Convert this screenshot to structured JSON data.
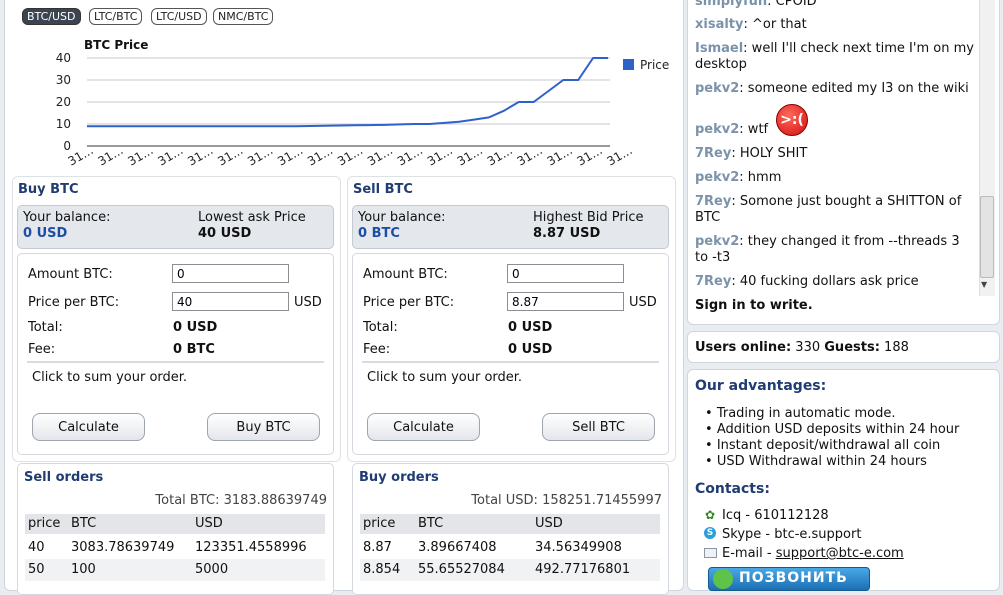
{
  "pairs": [
    "BTC/USD",
    "LTC/BTC",
    "LTC/USD",
    "NMC/BTC"
  ],
  "chart": {
    "title": "BTC Price",
    "legend": "Price",
    "tick_label": "31..."
  },
  "chart_data": {
    "type": "line",
    "title": "BTC Price",
    "series": [
      {
        "name": "Price",
        "color": "#2f62c9",
        "values": [
          9,
          9,
          9,
          9,
          9,
          9,
          9,
          9,
          9,
          9,
          9,
          9,
          9,
          9,
          9,
          9.1,
          9.2,
          9.3,
          9.4,
          9.5,
          9.6,
          9.8,
          10,
          10,
          10.5,
          11,
          12,
          13,
          16,
          20,
          20,
          25,
          30,
          30,
          40,
          40
        ]
      }
    ],
    "ylim": [
      0,
      40
    ],
    "yticks": [
      0,
      10,
      20,
      30,
      40
    ],
    "xtick_labels": [
      "31...",
      "31...",
      "31...",
      "31...",
      "31...",
      "31...",
      "31...",
      "31...",
      "31...",
      "31...",
      "31...",
      "31...",
      "31...",
      "31...",
      "31...",
      "31...",
      "31...",
      "31...",
      "31..."
    ]
  },
  "buy": {
    "title": "Buy BTC",
    "balance_label": "Your balance:",
    "balance_value": "0 USD",
    "price_label": "Lowest ask Price",
    "price_value": "40 USD",
    "amount_label": "Amount BTC:",
    "amount_value": "0",
    "ppb_label": "Price per BTC:",
    "ppb_value": "40",
    "ppb_unit": "USD",
    "total_label": "Total:",
    "total_value": "0 USD",
    "fee_label": "Fee:",
    "fee_value": "0 BTC",
    "hint": "Click to sum your order.",
    "calc_label": "Calculate",
    "action_label": "Buy BTC"
  },
  "sell": {
    "title": "Sell BTC",
    "balance_label": "Your balance:",
    "balance_value": "0 BTC",
    "price_label": "Highest Bid Price",
    "price_value": "8.87 USD",
    "amount_label": "Amount BTC:",
    "amount_value": "0",
    "ppb_label": "Price per BTC:",
    "ppb_value": "8.87",
    "ppb_unit": "USD",
    "total_label": "Total:",
    "total_value": "0 USD",
    "fee_label": "Fee:",
    "fee_value": "0 USD",
    "hint": "Click to sum your order.",
    "calc_label": "Calculate",
    "action_label": "Sell BTC"
  },
  "sell_orders": {
    "title": "Sell orders",
    "total": "Total BTC: 3183.88639749",
    "columns": [
      "price",
      "BTC",
      "USD"
    ],
    "rows": [
      [
        "40",
        "3083.78639749",
        "123351.4558996"
      ],
      [
        "50",
        "100",
        "5000"
      ]
    ]
  },
  "buy_orders": {
    "title": "Buy orders",
    "total": "Total USD: 158251.71455997",
    "columns": [
      "price",
      "BTC",
      "USD"
    ],
    "rows": [
      [
        "8.87",
        "3.89667408",
        "34.56349908"
      ],
      [
        "8.854",
        "55.65527084",
        "492.77176801"
      ]
    ]
  },
  "chat": [
    {
      "nick": "simplyfun",
      "text": ": CPOID"
    },
    {
      "nick": "xisalty",
      "text": ": ^or that"
    },
    {
      "nick": "Ismael",
      "text": ": well I'll check next time I'm on my desktop"
    },
    {
      "nick": "pekv2",
      "text": ": someone edited my I3 on the wiki"
    },
    {
      "nick": "pekv2",
      "text": ": wtf"
    },
    {
      "nick": "7Rey",
      "text": ": HOLY SHIT"
    },
    {
      "nick": "pekv2",
      "text": ": hmm"
    },
    {
      "nick": "7Rey",
      "text": ": Somone just bought a SHITTON of BTC"
    },
    {
      "nick": "pekv2",
      "text": ": they changed it from --threads 3 to -t3"
    },
    {
      "nick": "7Rey",
      "text": ": 40 fucking dollars ask price"
    }
  ],
  "sign_in": "Sign in to write.",
  "online": {
    "users_label": "Users online:",
    "users": "330",
    "guests_label": "Guests:",
    "guests": "188"
  },
  "advantages": {
    "title": "Our advantages:",
    "items": [
      "Trading in automatic mode.",
      "Addition USD deposits within 24 hour",
      "Instant deposit/withdrawal all coin",
      "USD Withdrawal within 24 hours"
    ]
  },
  "contacts": {
    "title": "Contacts:",
    "icq": "Icq - 610112128",
    "skype": "Skype - btc-e.support",
    "email_label": "E-mail - ",
    "email": "support@btc-e.com",
    "call_label": "ПОЗВОНИТЬ"
  }
}
